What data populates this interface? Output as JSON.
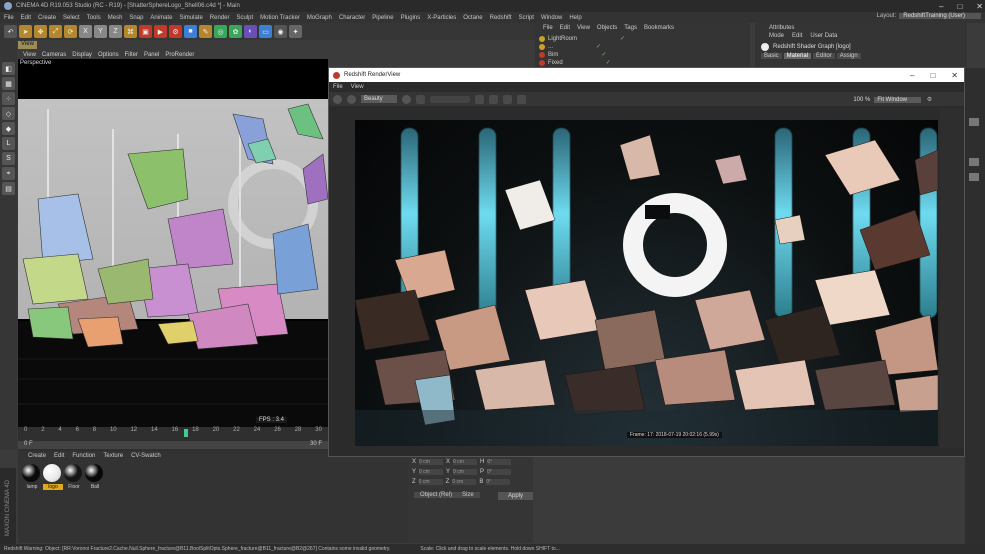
{
  "window": {
    "title": "CINEMA 4D R19.053 Studio (RC - R19) - [ShatterSphereLogo_Shell06.c4d *] - Main",
    "controls": [
      "–",
      "□",
      "✕"
    ]
  },
  "menubar": {
    "items": [
      "File",
      "Edit",
      "Create",
      "Select",
      "Tools",
      "Mesh",
      "Snap",
      "Animate",
      "Simulate",
      "Render",
      "Sculpt",
      "Motion Tracker",
      "MoGraph",
      "Character",
      "Pipeline",
      "Plugins",
      "X-Particles",
      "Octane",
      "Redshift",
      "Script",
      "Window",
      "Help"
    ],
    "layout_label": "Layout:",
    "layout_value": "RedshiftTraining (User)"
  },
  "toolbar": {
    "icons": [
      "undo-icon",
      "cursor-icon",
      "move-icon",
      "scale-icon",
      "rotate-icon",
      "x-axis-icon",
      "y-axis-icon",
      "z-axis-icon",
      "coord-icon",
      "render-region-icon",
      "render-view-icon",
      "render-settings-icon",
      "cube-icon",
      "pen-icon",
      "subdivision-icon",
      "array-icon",
      "deformer-icon",
      "floor-icon",
      "camera-icon",
      "light-icon"
    ]
  },
  "viewport": {
    "tab": "View",
    "menu": [
      "View",
      "Cameras",
      "Display",
      "Options",
      "Filter",
      "Panel",
      "ProRender"
    ],
    "label": "Perspective",
    "fps": "FPS : 3.4"
  },
  "timeline": {
    "ticks": [
      "0",
      "2",
      "4",
      "6",
      "8",
      "10",
      "12",
      "14",
      "16",
      "18",
      "20",
      "22",
      "24",
      "26",
      "28",
      "30"
    ],
    "start": "0 F",
    "end": "30 F",
    "current": "17 F"
  },
  "materials": {
    "menu": [
      "Create",
      "Edit",
      "Function",
      "Texture",
      "CV-Swatch"
    ],
    "items": [
      {
        "label": "lamp",
        "color": "#0a0a0a"
      },
      {
        "label": "logo",
        "color": "#f2f2f2"
      },
      {
        "label": "Floor",
        "color": "#151515"
      },
      {
        "label": "Ball",
        "color": "#080808"
      }
    ]
  },
  "maxon": {
    "label": "MAXON CINEMA 4D"
  },
  "coords": {
    "rows": [
      [
        "X",
        "0 cm",
        "X",
        "0 cm",
        "H",
        "0°"
      ],
      [
        "Y",
        "0 cm",
        "Y",
        "0 cm",
        "P",
        "0°"
      ],
      [
        "Z",
        "0 cm",
        "Z",
        "0 cm",
        "B",
        "0°"
      ]
    ],
    "mode": "Object (Rel)",
    "size": "Size",
    "apply": "Apply"
  },
  "objects": {
    "menu": [
      "File",
      "Edit",
      "View",
      "Objects",
      "Tags",
      "Bookmarks"
    ],
    "rows": [
      {
        "name": "LightRoom",
        "color": "#c9a227"
      },
      {
        "name": "...",
        "color": "#c9a227"
      },
      {
        "name": "Bim",
        "color": "#c0392b"
      },
      {
        "name": "Fixed",
        "color": "#c0392b"
      }
    ]
  },
  "attributes": {
    "title": "Attributes",
    "menu": [
      "Mode",
      "Edit",
      "User Data"
    ],
    "object": "Redshift Shader Graph [logo]",
    "tabs": [
      "Basic",
      "Material",
      "Editor",
      "Assign"
    ],
    "active_tab": "Material"
  },
  "renderview": {
    "title": "Redshift RenderView",
    "controls": [
      "–",
      "□",
      "✕"
    ],
    "menu": [
      "File",
      "View"
    ],
    "aov": "Beauty",
    "zoom": "100 %",
    "fit": "Fit Window",
    "frame_info": "Frame: 17: 2018-07-19 20:02:16 (5.99s)"
  },
  "statusbar": {
    "left": "Redshift Warning: Object: [RR:Voronoi Fracture2.Cache.Null.Sphere_fracture@B11.BoolSplitOpts.Sphere_fracture@B11_fracture@B2@267] Contains some invalid geometry.",
    "right": "Scale: Click and drag to scale elements. Hold down SHIFT to..."
  },
  "colors": {
    "accent": "#9c8c55",
    "light_strip": "#6fdbf0"
  }
}
